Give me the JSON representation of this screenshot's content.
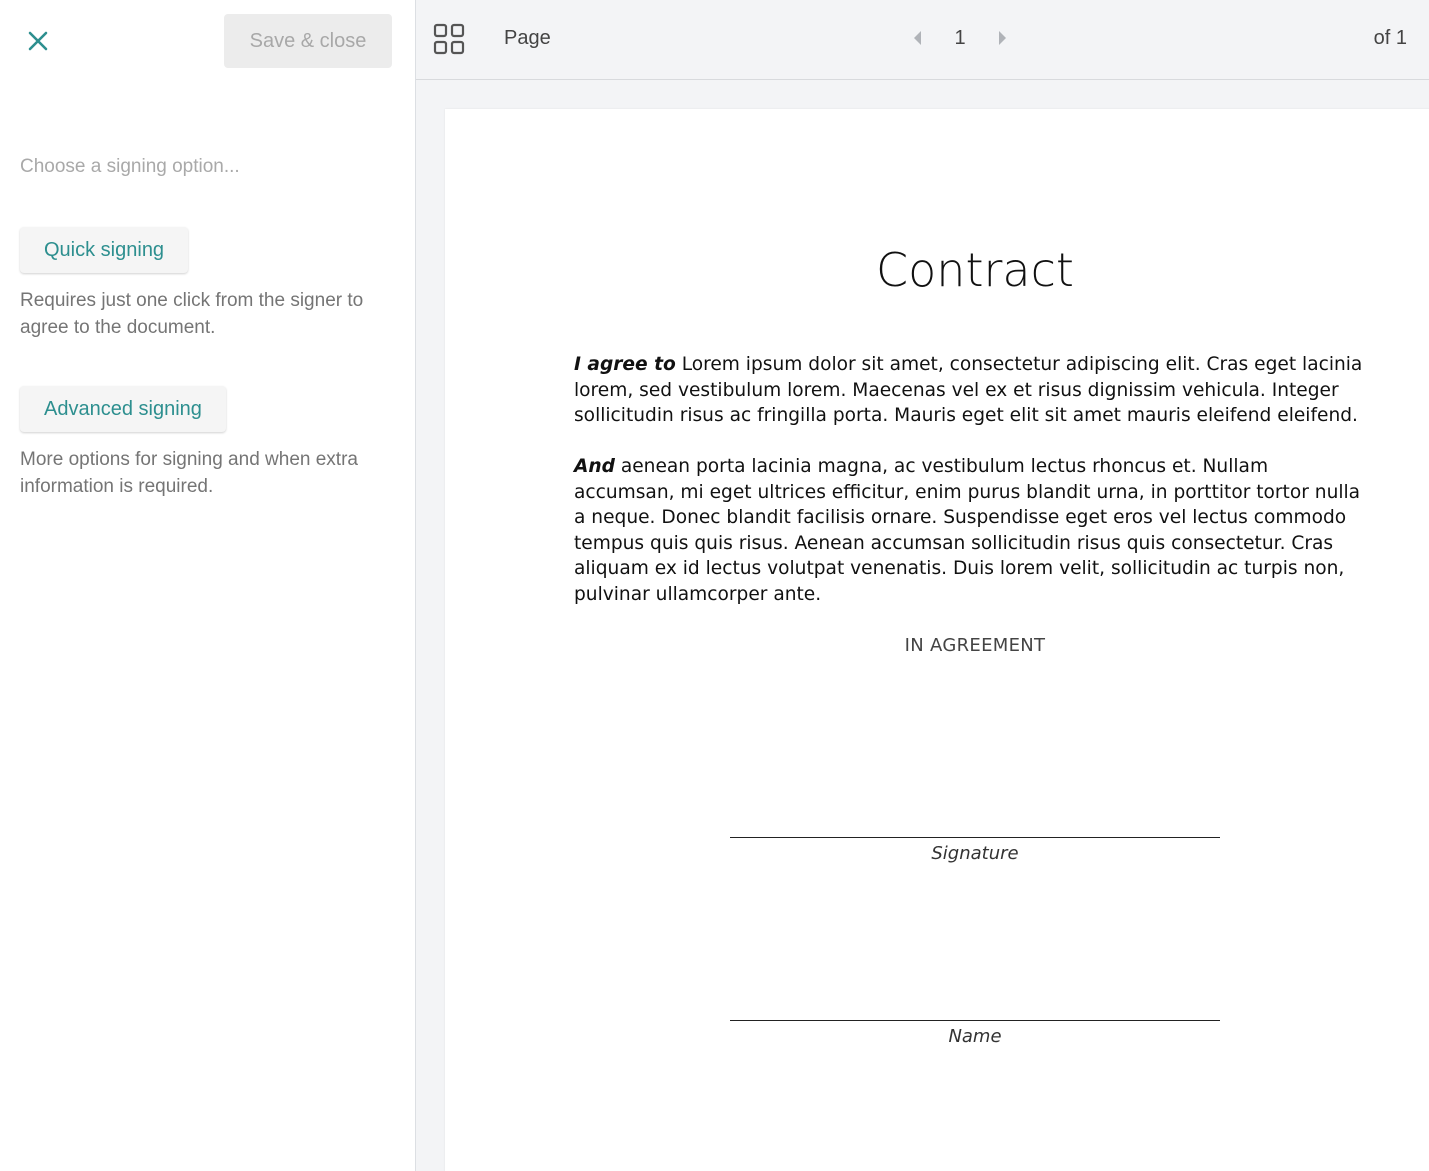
{
  "sidebar": {
    "save_label": "Save & close",
    "hint": "Choose a signing option...",
    "options": [
      {
        "label": "Quick signing",
        "description": "Requires just one click from the signer to agree to the document."
      },
      {
        "label": "Advanced signing",
        "description": "More options for signing and when extra information is required."
      }
    ]
  },
  "toolbar": {
    "page_label": "Page",
    "current_page": "1",
    "of_label": "of 1"
  },
  "document": {
    "title": "Contract",
    "paragraphs": [
      {
        "lead": "I agree to",
        "text": " Lorem ipsum dolor sit amet, consectetur adipiscing elit. Cras eget lacinia lorem, sed vestibulum lorem. Maecenas vel ex et risus dignissim vehicula. Integer sollicitudin risus ac fringilla porta. Mauris eget elit sit amet mauris eleifend eleifend."
      },
      {
        "lead": "And",
        "text": " aenean porta lacinia magna, ac vestibulum lectus rhoncus et. Nullam accumsan, mi eget ultrices efficitur, enim purus blandit urna, in porttitor tortor nulla a neque. Donec blandit facilisis ornare. Suspendisse eget eros vel lectus commodo tempus quis quis risus. Aenean accumsan sollicitudin risus quis consectetur. Cras aliquam ex id lectus volutpat venenatis. Duis lorem velit, sollicitudin ac turpis non, pulvinar ullamcorper ante."
      }
    ],
    "agreement": "IN AGREEMENT",
    "signature_caption": "Signature",
    "name_caption": "Name"
  },
  "colors": {
    "accent": "#2d8f8f",
    "disabled_text": "#a8a8a8"
  },
  "icons": {
    "close": "close-icon",
    "grid": "grid-view-icon",
    "prev": "caret-left-icon",
    "next": "caret-right-icon"
  }
}
